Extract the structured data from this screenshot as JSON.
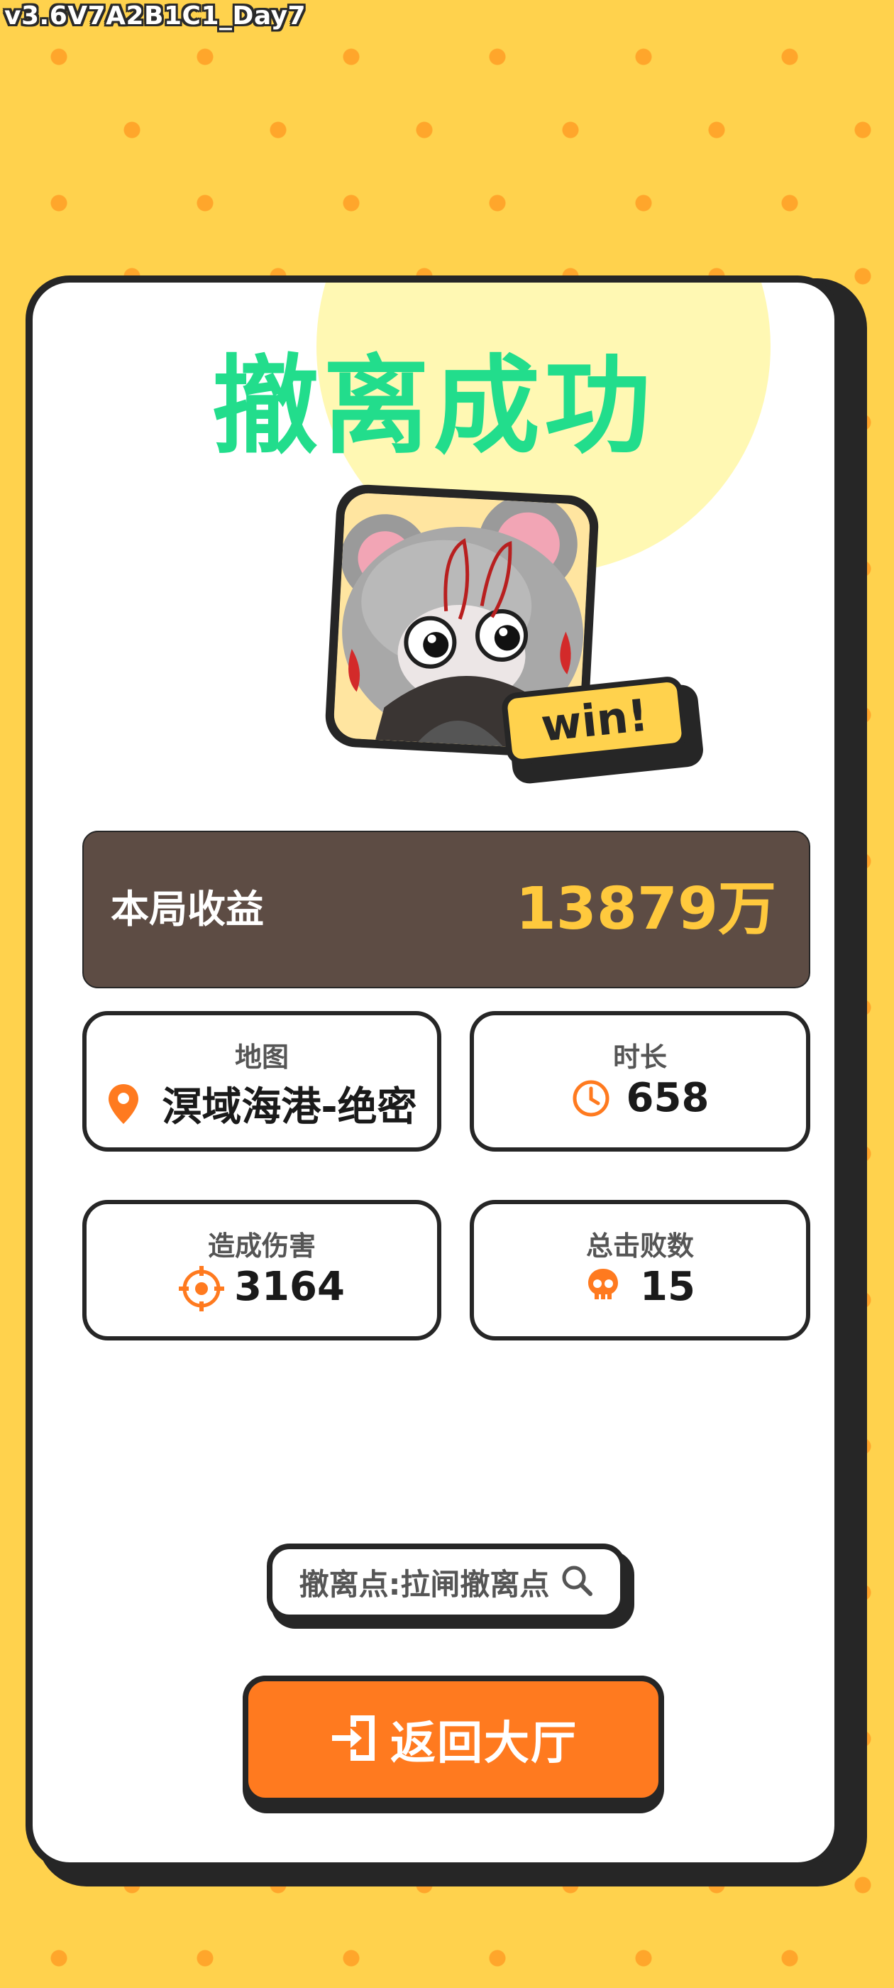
{
  "version_label": "v3.6V7A2B1C1_Day7",
  "result": {
    "title": "撤离成功",
    "badge": "win!"
  },
  "earnings": {
    "label": "本局收益",
    "value": "13879万"
  },
  "stats": {
    "map": {
      "label": "地图",
      "value": "溟域海港-绝密",
      "icon": "location-pin-icon"
    },
    "duration": {
      "label": "时长",
      "value": "658",
      "icon": "clock-icon"
    },
    "damage": {
      "label": "造成伤害",
      "value": "3164",
      "icon": "crosshair-icon"
    },
    "kills": {
      "label": "总击败数",
      "value": "15",
      "icon": "skull-icon"
    }
  },
  "extraction_point": {
    "label": "撤离点:拉闸撤离点",
    "icon": "search-icon"
  },
  "return_button": {
    "label": "返回大厅",
    "icon": "exit-door-icon"
  },
  "colors": {
    "background": "#ffd24d",
    "dots": "#ffa62b",
    "title_green": "#22dd8c",
    "earnings_bg": "#5d4c44",
    "earnings_value": "#ffc93d",
    "accent_orange": "#ff7a1f",
    "outline": "#262626"
  }
}
